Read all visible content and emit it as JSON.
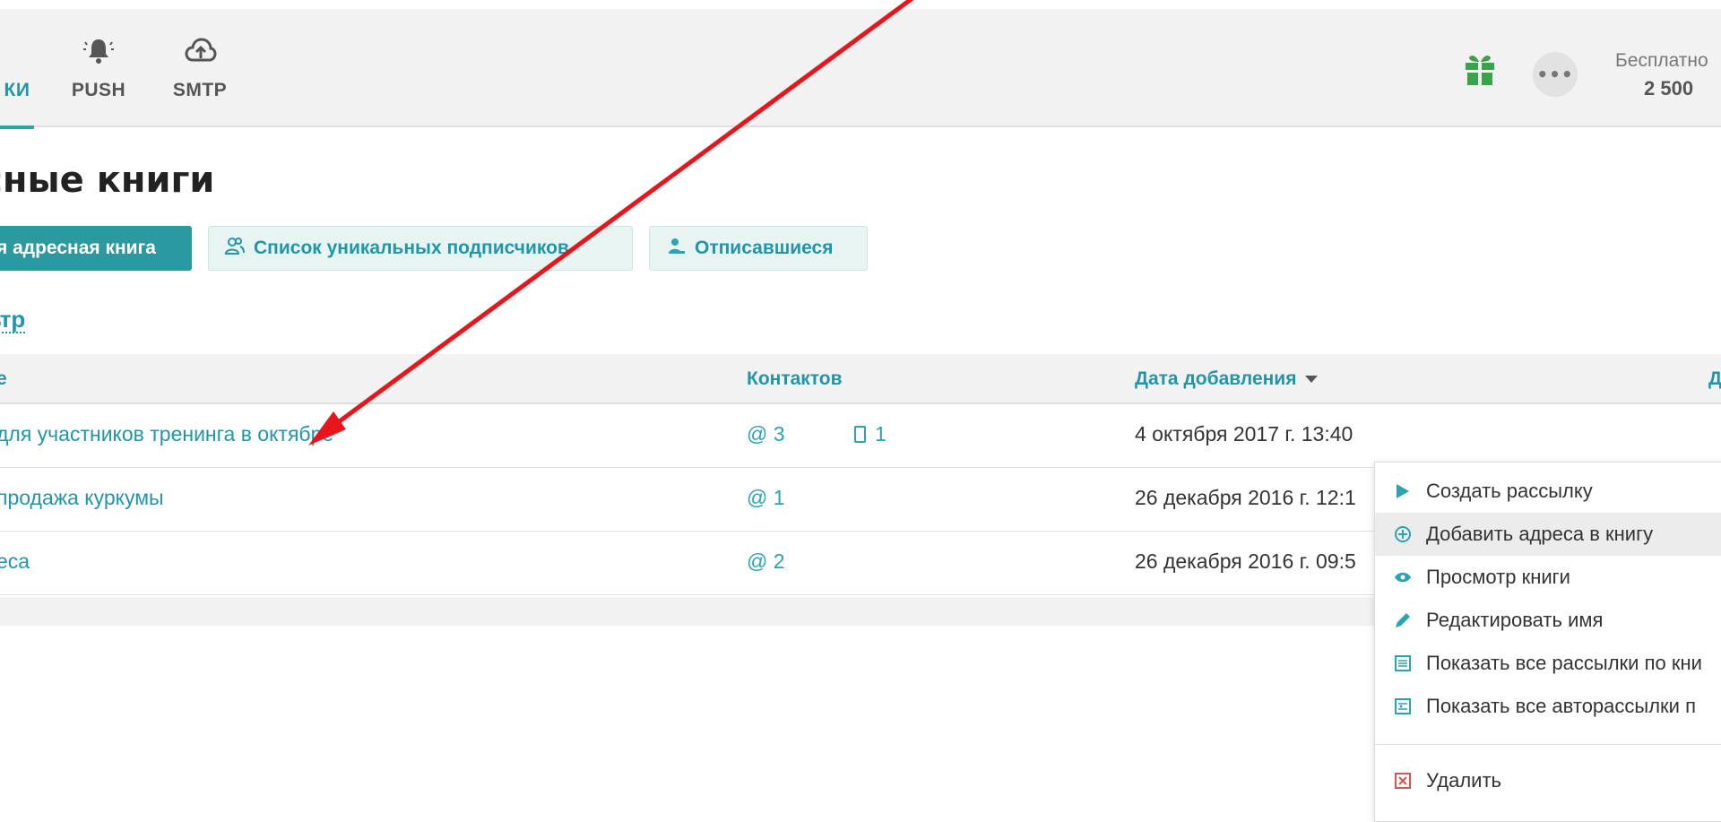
{
  "nav": {
    "items": [
      {
        "label": "КИ",
        "icon": "book-icon",
        "active": true
      },
      {
        "label": "PUSH",
        "icon": "bell-icon",
        "active": false
      },
      {
        "label": "SMTP",
        "icon": "cloud-upload-icon",
        "active": false
      }
    ]
  },
  "header": {
    "gift_icon": "gift-icon",
    "more_label": "•••",
    "free_label": "Бесплатно",
    "free_count": "2 500"
  },
  "page": {
    "title": "есные книги",
    "buttons": {
      "new_book": "я адресная книга",
      "unique_list": "Список уникальных подписчиков",
      "unsubscribed": "Отписавшиеся"
    },
    "filter_label": "ьтр"
  },
  "table": {
    "headers": {
      "name": "е",
      "contacts": "Контактов",
      "date_added": "Дата добавления",
      "cut": "Д"
    },
    "rows": [
      {
        "name": "для участников тренинга в октябре",
        "emails": "@ 3",
        "phones": "1",
        "date": "4 октября 2017 г. 13:40"
      },
      {
        "name": "продажа куркумы",
        "emails": "@ 1",
        "phones": "",
        "date": "26 декабря 2016 г. 12:1"
      },
      {
        "name": "еса",
        "emails": "@ 2",
        "phones": "",
        "date": "26 декабря 2016 г. 09:5"
      }
    ]
  },
  "context_menu": {
    "items": [
      {
        "label": "Создать рассылку",
        "icon": "play-icon"
      },
      {
        "label": "Добавить адреса в книгу",
        "icon": "plus-circle-icon"
      },
      {
        "label": "Просмотр книги",
        "icon": "eye-icon"
      },
      {
        "label": "Редактировать имя",
        "icon": "pencil-icon"
      },
      {
        "label": "Показать все рассылки по кни",
        "icon": "list-icon"
      },
      {
        "label": "Показать все авторассылки п",
        "icon": "autolist-icon"
      }
    ],
    "delete_label": "Удалить",
    "delete_icon": "delete-icon"
  },
  "colors": {
    "accent": "#2196a8",
    "primary_button": "#2a9aa0",
    "secondary_button_bg": "#e7f4f1",
    "annotation_arrow": "#e8151b",
    "delete_red": "#d9534f"
  }
}
